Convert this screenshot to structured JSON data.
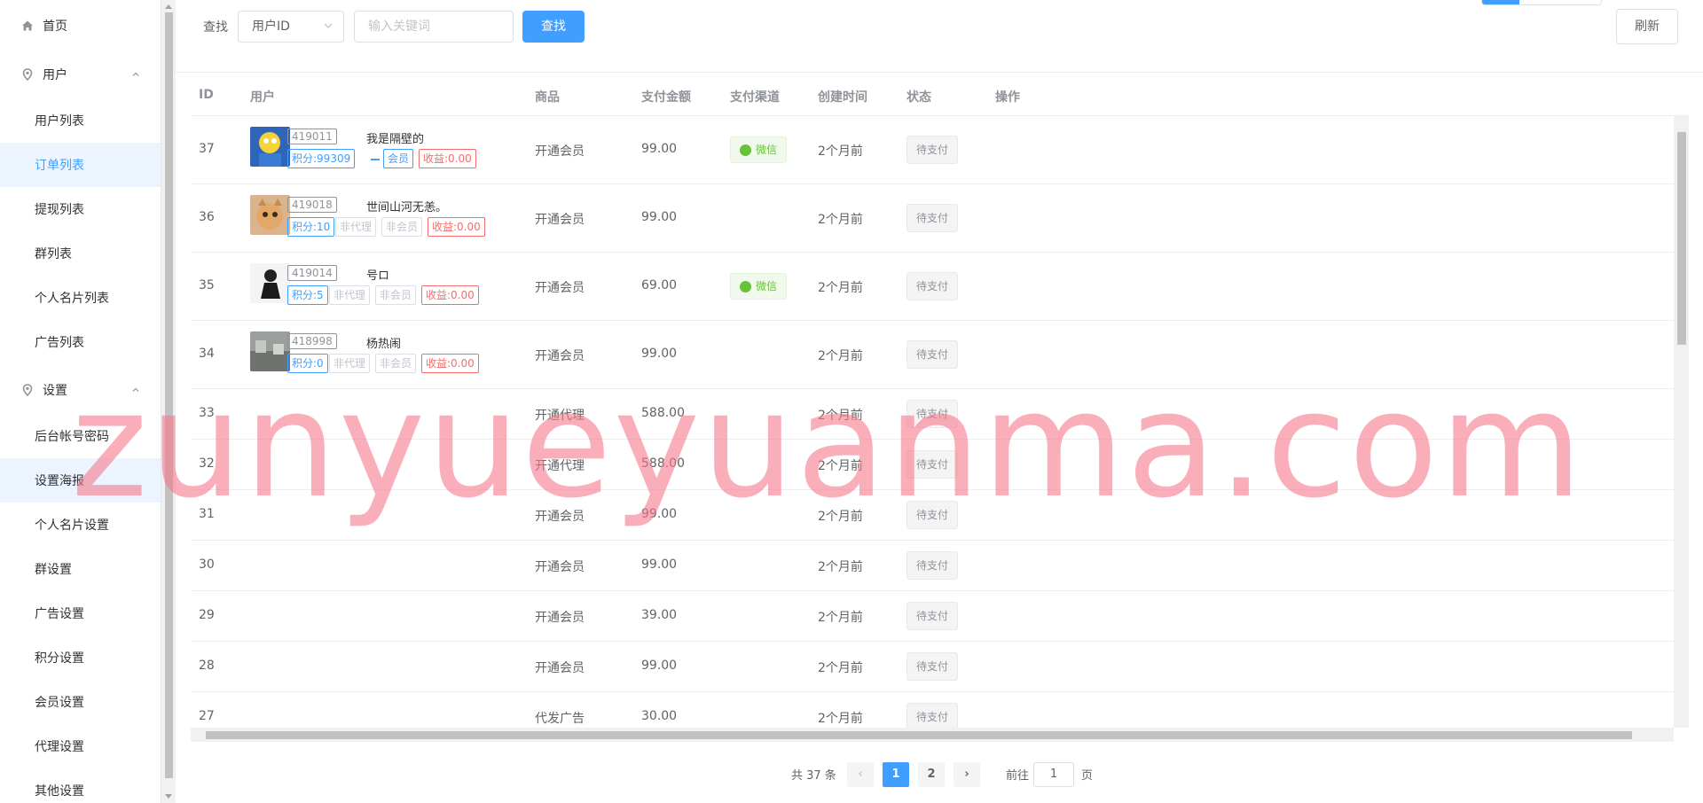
{
  "sidebar": {
    "home": "首页",
    "users_group": "用户",
    "user_list": "用户列表",
    "order_list": "订单列表",
    "withdraw_list": "提现列表",
    "group_list": "群列表",
    "card_list": "个人名片列表",
    "ad_list": "广告列表",
    "settings_group": "设置",
    "admin_password": "后台帐号密码",
    "poster_settings": "设置海报",
    "card_settings": "个人名片设置",
    "group_settings": "群设置",
    "ad_settings": "广告设置",
    "points_settings": "积分设置",
    "member_settings": "会员设置",
    "agent_settings": "代理设置",
    "other_settings": "其他设置"
  },
  "toolbar": {
    "find_label": "查找",
    "select_value": "用户ID",
    "keyword_placeholder": "输入关键词",
    "search_label": "查找",
    "refresh_label": "刷新"
  },
  "table": {
    "headers": [
      "ID",
      "用户",
      "商品",
      "支付金额",
      "支付渠道",
      "创建时间",
      "状态",
      "操作"
    ],
    "rows": [
      {
        "id": "37",
        "user_id": "419011",
        "user_name": "我是隔壁的",
        "tags": [
          "积分:99309",
          "会员",
          "收益:0.00"
        ],
        "product": "开通会员",
        "amount": "99.00",
        "channel": "微信",
        "time": "2个月前",
        "status": "待支付"
      },
      {
        "id": "36",
        "user_id": "419018",
        "user_name": "世间山河无恙。",
        "tags": [
          "积分:10",
          "非代理",
          "非会员",
          "收益:0.00"
        ],
        "product": "开通会员",
        "amount": "99.00",
        "channel": "",
        "time": "2个月前",
        "status": "待支付"
      },
      {
        "id": "35",
        "user_id": "419014",
        "user_name": "号ロ",
        "tags": [
          "积分:5",
          "非代理",
          "非会员",
          "收益:0.00"
        ],
        "product": "开通会员",
        "amount": "69.00",
        "channel": "微信",
        "time": "2个月前",
        "status": "待支付"
      },
      {
        "id": "34",
        "user_id": "418998",
        "user_name": "杨热闹",
        "tags": [
          "积分:0",
          "非代理",
          "非会员",
          "收益:0.00"
        ],
        "product": "开通会员",
        "amount": "99.00",
        "channel": "",
        "time": "2个月前",
        "status": "待支付"
      },
      {
        "id": "33",
        "product": "开通代理",
        "amount": "588.00",
        "time": "2个月前",
        "status": "待支付"
      },
      {
        "id": "32",
        "product": "开通代理",
        "amount": "588.00",
        "time": "2个月前",
        "status": "待支付"
      },
      {
        "id": "31",
        "product": "开通会员",
        "amount": "99.00",
        "time": "2个月前",
        "status": "待支付"
      },
      {
        "id": "30",
        "product": "开通会员",
        "amount": "99.00",
        "time": "2个月前",
        "status": "待支付"
      },
      {
        "id": "29",
        "product": "开通会员",
        "amount": "39.00",
        "time": "2个月前",
        "status": "待支付"
      },
      {
        "id": "28",
        "product": "开通会员",
        "amount": "99.00",
        "time": "2个月前",
        "status": "待支付"
      },
      {
        "id": "27",
        "product": "代发广告",
        "amount": "30.00",
        "time": "2个月前",
        "status": "待支付"
      }
    ]
  },
  "pagination": {
    "total": "共 37 条",
    "pages": [
      "1",
      "2"
    ],
    "prev": "‹",
    "next": "›",
    "goto_label": "前往",
    "goto_value": "1",
    "page_suffix": "页"
  },
  "watermark": "zunyueyuanma.com",
  "colors": {
    "accent": "#409eff",
    "danger": "#f56c6c",
    "success": "#67c23a"
  }
}
